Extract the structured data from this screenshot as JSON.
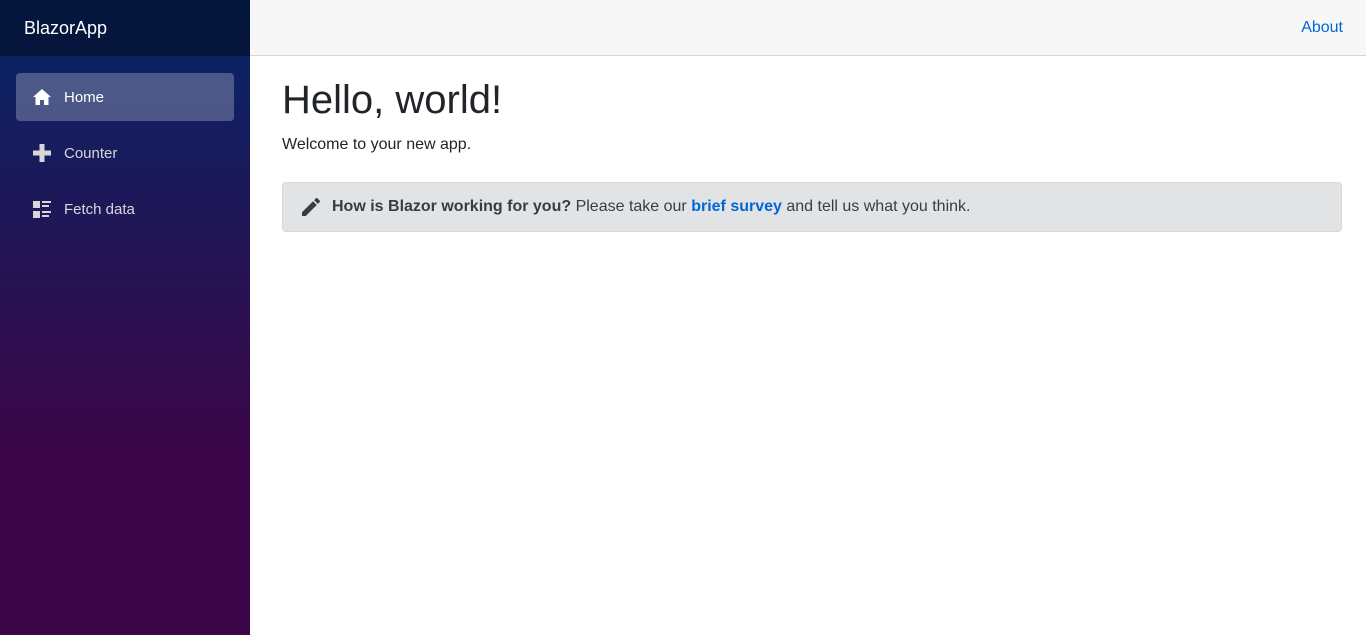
{
  "brand": {
    "name": "BlazorApp"
  },
  "sidebar": {
    "items": [
      {
        "label": "Home",
        "icon": "home-icon",
        "active": true
      },
      {
        "label": "Counter",
        "icon": "plus-icon",
        "active": false
      },
      {
        "label": "Fetch data",
        "icon": "list-rich-icon",
        "active": false
      }
    ]
  },
  "topbar": {
    "about_label": "About"
  },
  "main": {
    "title": "Hello, world!",
    "welcome": "Welcome to your new app.",
    "survey": {
      "icon": "pencil-icon",
      "question": "How is Blazor working for you?",
      "text_before": " Please take our ",
      "link_label": "brief survey",
      "text_after": " and tell us what you think."
    }
  },
  "colors": {
    "sidebar_gradient_top": "#052767",
    "sidebar_gradient_bottom": "#3a0647",
    "link": "#0366d6",
    "alert_bg": "#e2e3e5"
  }
}
